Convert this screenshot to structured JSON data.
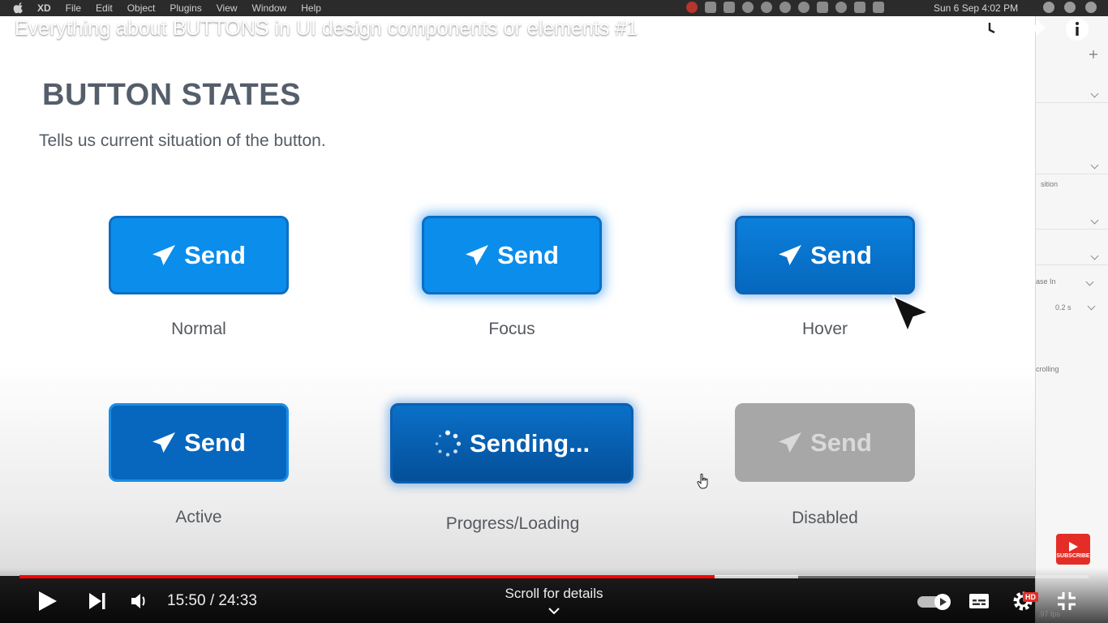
{
  "menubar": {
    "app": "XD",
    "items": [
      "File",
      "Edit",
      "Object",
      "Plugins",
      "View",
      "Window",
      "Help"
    ],
    "clock": "Sun 6 Sep  4:02 PM"
  },
  "xd_panel": {
    "labels": [
      "sition",
      "ase In",
      "0.2 s",
      "crolling"
    ]
  },
  "video": {
    "title": "Everything about BUTTONS in UI design components or elements #1",
    "current_time": "15:50",
    "separator": " / ",
    "duration": "24:33",
    "time_text": "15:50 / 24:33",
    "played_fraction": 0.6505,
    "buffered_fraction": 0.7285,
    "scroll_hint": "Scroll for details",
    "hd_badge": "HD",
    "subscribe_label": "SUBSCRIBE",
    "fps_text": ".97 fps"
  },
  "slide": {
    "title": "BUTTON STATES",
    "subtitle": "Tells us current situation of the button.",
    "states": [
      {
        "button_label": "Send",
        "caption": "Normal"
      },
      {
        "button_label": "Send",
        "caption": "Focus"
      },
      {
        "button_label": "Send",
        "caption": "Hover"
      },
      {
        "button_label": "Send",
        "caption": "Active"
      },
      {
        "button_label": "Sending...",
        "caption": "Progress/Loading"
      },
      {
        "button_label": "Send",
        "caption": "Disabled"
      }
    ]
  },
  "icons": {
    "send": "paper-plane-icon",
    "loading": "spinner-icon"
  },
  "colors": {
    "button_blue": "#0b8deb",
    "button_dark_blue": "#0767bf",
    "disabled_gray": "#a7a7a7",
    "progress_red": "#ff0000",
    "title_gray": "#555e6b"
  }
}
